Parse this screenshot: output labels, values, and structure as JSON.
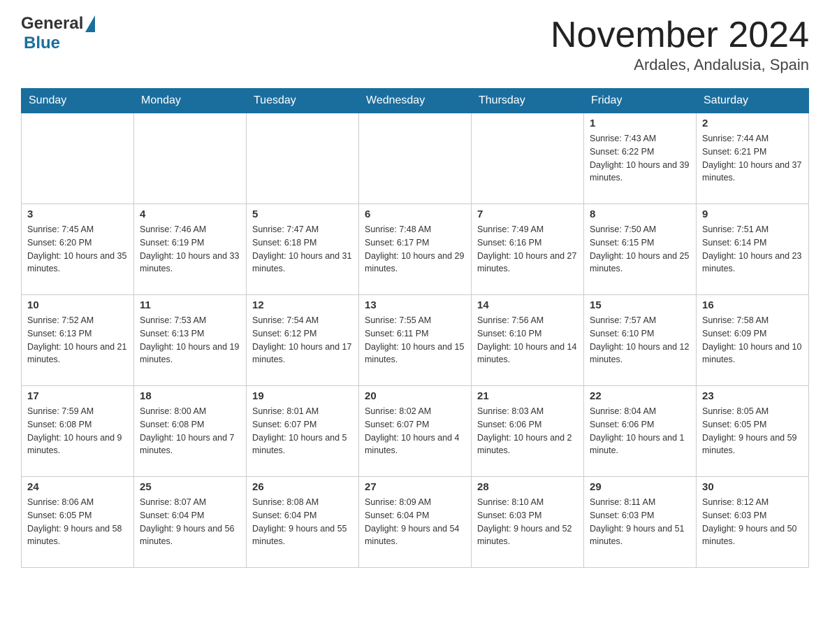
{
  "logo": {
    "text_general": "General",
    "triangle_symbol": "▶",
    "text_blue": "Blue"
  },
  "header": {
    "title": "November 2024",
    "subtitle": "Ardales, Andalusia, Spain"
  },
  "weekdays": [
    "Sunday",
    "Monday",
    "Tuesday",
    "Wednesday",
    "Thursday",
    "Friday",
    "Saturday"
  ],
  "weeks": [
    [
      {
        "day": "",
        "sunrise": "",
        "sunset": "",
        "daylight": ""
      },
      {
        "day": "",
        "sunrise": "",
        "sunset": "",
        "daylight": ""
      },
      {
        "day": "",
        "sunrise": "",
        "sunset": "",
        "daylight": ""
      },
      {
        "day": "",
        "sunrise": "",
        "sunset": "",
        "daylight": ""
      },
      {
        "day": "",
        "sunrise": "",
        "sunset": "",
        "daylight": ""
      },
      {
        "day": "1",
        "sunrise": "Sunrise: 7:43 AM",
        "sunset": "Sunset: 6:22 PM",
        "daylight": "Daylight: 10 hours and 39 minutes."
      },
      {
        "day": "2",
        "sunrise": "Sunrise: 7:44 AM",
        "sunset": "Sunset: 6:21 PM",
        "daylight": "Daylight: 10 hours and 37 minutes."
      }
    ],
    [
      {
        "day": "3",
        "sunrise": "Sunrise: 7:45 AM",
        "sunset": "Sunset: 6:20 PM",
        "daylight": "Daylight: 10 hours and 35 minutes."
      },
      {
        "day": "4",
        "sunrise": "Sunrise: 7:46 AM",
        "sunset": "Sunset: 6:19 PM",
        "daylight": "Daylight: 10 hours and 33 minutes."
      },
      {
        "day": "5",
        "sunrise": "Sunrise: 7:47 AM",
        "sunset": "Sunset: 6:18 PM",
        "daylight": "Daylight: 10 hours and 31 minutes."
      },
      {
        "day": "6",
        "sunrise": "Sunrise: 7:48 AM",
        "sunset": "Sunset: 6:17 PM",
        "daylight": "Daylight: 10 hours and 29 minutes."
      },
      {
        "day": "7",
        "sunrise": "Sunrise: 7:49 AM",
        "sunset": "Sunset: 6:16 PM",
        "daylight": "Daylight: 10 hours and 27 minutes."
      },
      {
        "day": "8",
        "sunrise": "Sunrise: 7:50 AM",
        "sunset": "Sunset: 6:15 PM",
        "daylight": "Daylight: 10 hours and 25 minutes."
      },
      {
        "day": "9",
        "sunrise": "Sunrise: 7:51 AM",
        "sunset": "Sunset: 6:14 PM",
        "daylight": "Daylight: 10 hours and 23 minutes."
      }
    ],
    [
      {
        "day": "10",
        "sunrise": "Sunrise: 7:52 AM",
        "sunset": "Sunset: 6:13 PM",
        "daylight": "Daylight: 10 hours and 21 minutes."
      },
      {
        "day": "11",
        "sunrise": "Sunrise: 7:53 AM",
        "sunset": "Sunset: 6:13 PM",
        "daylight": "Daylight: 10 hours and 19 minutes."
      },
      {
        "day": "12",
        "sunrise": "Sunrise: 7:54 AM",
        "sunset": "Sunset: 6:12 PM",
        "daylight": "Daylight: 10 hours and 17 minutes."
      },
      {
        "day": "13",
        "sunrise": "Sunrise: 7:55 AM",
        "sunset": "Sunset: 6:11 PM",
        "daylight": "Daylight: 10 hours and 15 minutes."
      },
      {
        "day": "14",
        "sunrise": "Sunrise: 7:56 AM",
        "sunset": "Sunset: 6:10 PM",
        "daylight": "Daylight: 10 hours and 14 minutes."
      },
      {
        "day": "15",
        "sunrise": "Sunrise: 7:57 AM",
        "sunset": "Sunset: 6:10 PM",
        "daylight": "Daylight: 10 hours and 12 minutes."
      },
      {
        "day": "16",
        "sunrise": "Sunrise: 7:58 AM",
        "sunset": "Sunset: 6:09 PM",
        "daylight": "Daylight: 10 hours and 10 minutes."
      }
    ],
    [
      {
        "day": "17",
        "sunrise": "Sunrise: 7:59 AM",
        "sunset": "Sunset: 6:08 PM",
        "daylight": "Daylight: 10 hours and 9 minutes."
      },
      {
        "day": "18",
        "sunrise": "Sunrise: 8:00 AM",
        "sunset": "Sunset: 6:08 PM",
        "daylight": "Daylight: 10 hours and 7 minutes."
      },
      {
        "day": "19",
        "sunrise": "Sunrise: 8:01 AM",
        "sunset": "Sunset: 6:07 PM",
        "daylight": "Daylight: 10 hours and 5 minutes."
      },
      {
        "day": "20",
        "sunrise": "Sunrise: 8:02 AM",
        "sunset": "Sunset: 6:07 PM",
        "daylight": "Daylight: 10 hours and 4 minutes."
      },
      {
        "day": "21",
        "sunrise": "Sunrise: 8:03 AM",
        "sunset": "Sunset: 6:06 PM",
        "daylight": "Daylight: 10 hours and 2 minutes."
      },
      {
        "day": "22",
        "sunrise": "Sunrise: 8:04 AM",
        "sunset": "Sunset: 6:06 PM",
        "daylight": "Daylight: 10 hours and 1 minute."
      },
      {
        "day": "23",
        "sunrise": "Sunrise: 8:05 AM",
        "sunset": "Sunset: 6:05 PM",
        "daylight": "Daylight: 9 hours and 59 minutes."
      }
    ],
    [
      {
        "day": "24",
        "sunrise": "Sunrise: 8:06 AM",
        "sunset": "Sunset: 6:05 PM",
        "daylight": "Daylight: 9 hours and 58 minutes."
      },
      {
        "day": "25",
        "sunrise": "Sunrise: 8:07 AM",
        "sunset": "Sunset: 6:04 PM",
        "daylight": "Daylight: 9 hours and 56 minutes."
      },
      {
        "day": "26",
        "sunrise": "Sunrise: 8:08 AM",
        "sunset": "Sunset: 6:04 PM",
        "daylight": "Daylight: 9 hours and 55 minutes."
      },
      {
        "day": "27",
        "sunrise": "Sunrise: 8:09 AM",
        "sunset": "Sunset: 6:04 PM",
        "daylight": "Daylight: 9 hours and 54 minutes."
      },
      {
        "day": "28",
        "sunrise": "Sunrise: 8:10 AM",
        "sunset": "Sunset: 6:03 PM",
        "daylight": "Daylight: 9 hours and 52 minutes."
      },
      {
        "day": "29",
        "sunrise": "Sunrise: 8:11 AM",
        "sunset": "Sunset: 6:03 PM",
        "daylight": "Daylight: 9 hours and 51 minutes."
      },
      {
        "day": "30",
        "sunrise": "Sunrise: 8:12 AM",
        "sunset": "Sunset: 6:03 PM",
        "daylight": "Daylight: 9 hours and 50 minutes."
      }
    ]
  ]
}
